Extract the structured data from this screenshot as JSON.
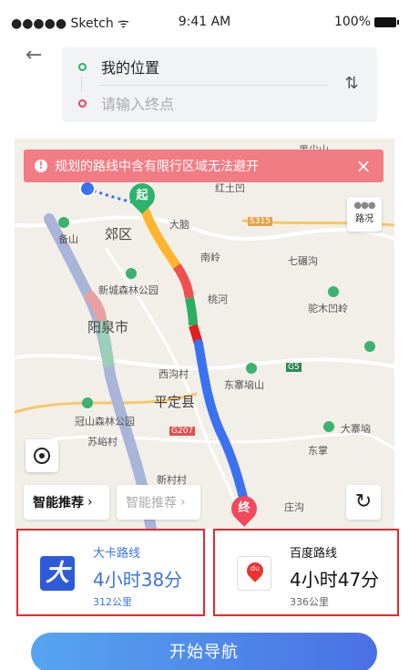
{
  "status_bar": {
    "carrier": "●●●●● Sketch ᯤ",
    "time": "9:41 AM",
    "battery": "100%"
  },
  "header": {
    "back_icon": "back-arrow-icon"
  },
  "route_input": {
    "origin": "我的位置",
    "destination_placeholder": "请输入终点",
    "swap_icon": "swap-icon"
  },
  "alert": {
    "text": "规划的路线中含有限行区域无法避开",
    "icon": "info-icon",
    "close": "×"
  },
  "map": {
    "traffic_button": "路况",
    "labels": {
      "jiaoqu": "郊区",
      "yangquan": "阳泉市",
      "pingding": "平定县",
      "xincheng": "新城森林公园",
      "dongzhai": "东寨垴山",
      "tuomu": "驼木凹岭",
      "guanshan": "冠山森林公园",
      "dazhai": "大寨垴",
      "hongtu": "红土凹",
      "heijian": "黑尖山",
      "danao": "大脑",
      "nanling": "南岭",
      "qiyiao": "七碾沟",
      "beishan": "备山",
      "taocun": "桃河",
      "xiyang": "西沟村",
      "suyu": "苏峪村",
      "xinzhuang": "新村村",
      "zhuangcun": "庄沟",
      "chouqu": "东掌",
      "g207": "G207",
      "g5": "G5",
      "s315": "S315"
    },
    "start_marker": "起",
    "end_marker": "终"
  },
  "recommend": {
    "smart_1": "智能推荐",
    "smart_2": "智能推荐",
    "chevron": "›",
    "refresh_icon": "refresh-icon",
    "locate_icon": "locate-icon"
  },
  "routes": [
    {
      "name": "大卡路线",
      "time": "4小时38分",
      "distance": "312公里",
      "logo": "daka-logo"
    },
    {
      "name": "百度路线",
      "time": "4小时47分",
      "distance": "336公里",
      "logo": "baidu-map-logo"
    }
  ],
  "nav_button": "开始导航",
  "colors": {
    "alert": "#f27c84",
    "selected_route": "#3a74e0",
    "highlight_border": "#e8282b",
    "start": "#2cb46a",
    "end": "#f04a5c"
  }
}
